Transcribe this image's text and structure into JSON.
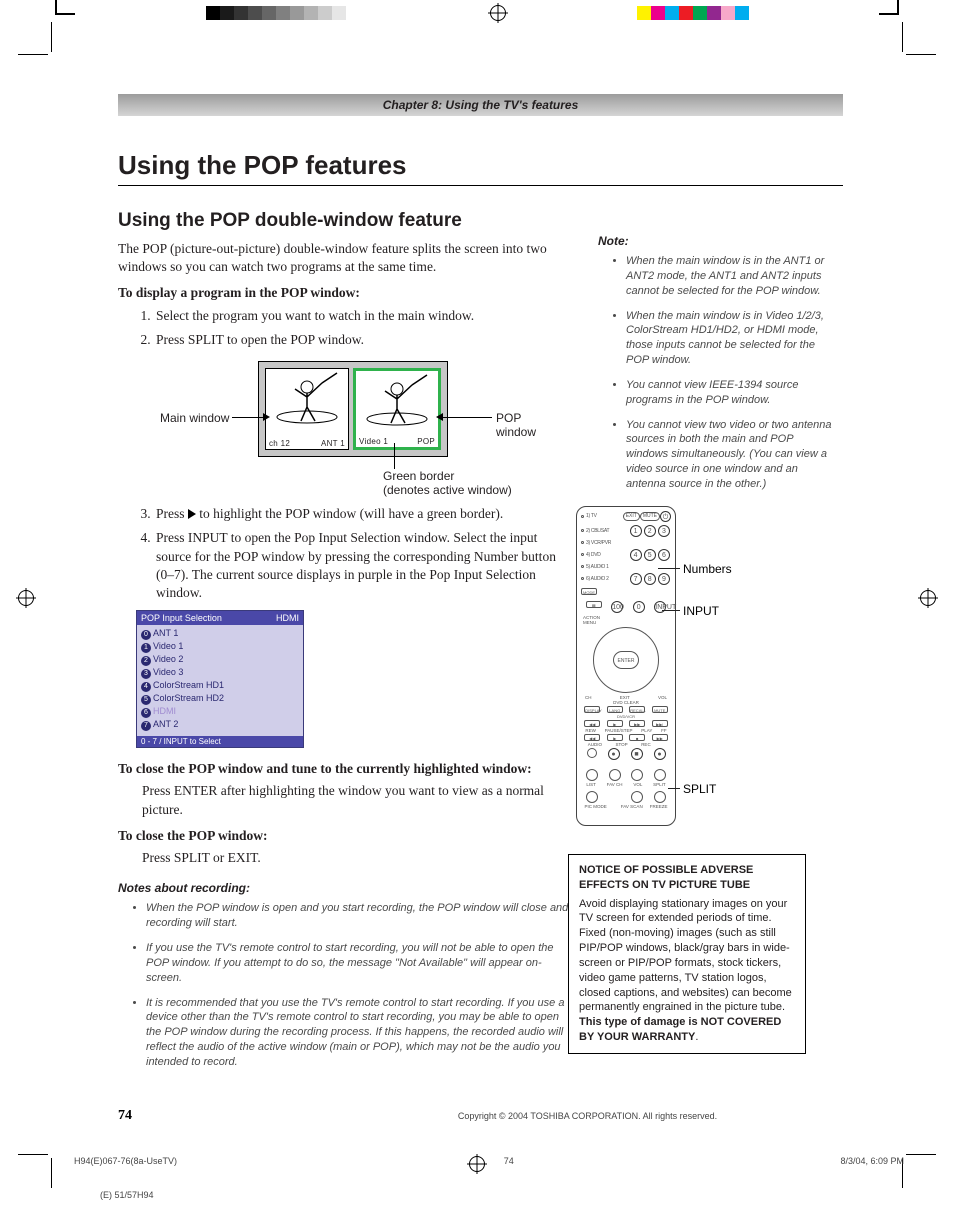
{
  "chapterBar": "Chapter 8: Using the TV's features",
  "h1": "Using the POP features",
  "h2": "Using the POP double-window feature",
  "intro": "The POP (picture-out-picture) double-window feature splits the screen into two windows so you can watch two programs at the same time.",
  "bold1": "To display a program in the POP window:",
  "steps12": [
    "Select the program you want to watch in the main window.",
    "Press SPLIT to open the POP window."
  ],
  "diag": {
    "main": "Main window",
    "pop": "POP window",
    "ch12": "ch 12",
    "ant1": "ANT 1",
    "video1": "Video 1",
    "popLbl": "POP",
    "gb1": "Green border",
    "gb2": "(denotes active window)"
  },
  "steps34": [
    "Press ▶ to highlight the POP window (will have a green border).",
    "Press INPUT to open the Pop Input Selection window. Select the input source for the POP window by pressing the corresponding Number button (0–7). The current source displays in purple in the Pop Input Selection window."
  ],
  "popMenu": {
    "title": "POP Input Selection",
    "right": "HDMI",
    "rows": [
      "ANT 1",
      "Video 1",
      "Video 2",
      "Video 3",
      "ColorStream HD1",
      "ColorStream HD2",
      "HDMI",
      "ANT 2"
    ],
    "foot": "0 - 7 / INPUT to Select"
  },
  "bold2": "To close the POP window and tune to the currently highlighted window:",
  "p2": "Press ENTER after highlighting the window you want to view as a normal picture.",
  "bold3": "To close the POP window:",
  "p3": "Press SPLIT or EXIT.",
  "recNotesHead": "Notes about recording:",
  "recNotes": [
    "When the POP window is open and you start recording, the POP window will close and recording will start.",
    "If you use the TV's remote control to start recording, you will not be able to open the POP window. If you attempt to do so, the message \"Not Available\" will appear on-screen.",
    "It is recommended that you use the TV's remote control to start recording. If you use a device other than the TV's remote control to start recording, you may be able to open the POP window during the recording process. If this happens, the recorded audio will reflect the audio of the active window (main or POP), which may not be the audio you intended to record."
  ],
  "noteHead": "Note:",
  "rightNotes": [
    "When the main window is in the ANT1 or ANT2 mode, the ANT1 and ANT2 inputs cannot be selected for the POP window.",
    "When the main window is in Video 1/2/3, ColorStream HD1/HD2, or HDMI mode, those inputs cannot be selected for the POP window.",
    "You cannot view IEEE-1394 source programs in the POP window.",
    "You cannot view two video or two antenna sources in both the main and POP windows simultaneously. (You can view a video source in one window and an antenna source in the other.)"
  ],
  "remote": {
    "modes": [
      "1) TV",
      "2) CBL/SAT",
      "3) VCR/PVR",
      "4) DVD",
      "5) AUDIO 1",
      "6) AUDIO 2"
    ],
    "MODE": "MODE",
    "EXIT": "EXIT",
    "MUTE": "MUTE",
    "POWER": "POWER",
    "co1": "Numbers",
    "co2": "INPUT",
    "co3": "SPLIT",
    "enter": "ENTER",
    "labels": [
      "REW",
      "PAUSE/STEP",
      "PLAY",
      "FF",
      "AUDIO",
      "STOP",
      "REC"
    ],
    "bottom": [
      "LIST",
      "FAV CH",
      "VOL",
      "SPLIT"
    ],
    "bottom2": [
      "PIC MODE",
      "",
      "FAV SCAN",
      "FREEZE"
    ],
    "corner": [
      "DISPLAY",
      "LANG",
      "RECALL",
      "MUTE"
    ],
    "mid": [
      "◀◀",
      "▶",
      "▶▶",
      "▶▶|"
    ],
    "blk": [
      "DVD/VCR",
      "SKIP/SRCH"
    ],
    "ch": "CH",
    "vol": "VOL",
    "exit2": "EXIT",
    "dvdclear": "DVD CLEAR"
  },
  "notice": {
    "head": "NOTICE OF POSSIBLE ADVERSE EFFECTS ON TV PICTURE TUBE",
    "body1": "Avoid displaying stationary images on your TV screen for extended periods of time. Fixed (non-moving) images (such as still PIP/POP windows, black/gray bars in wide-screen or PIP/POP formats, stock tickers, video game patterns, TV station logos, closed captions, and websites) can become permanently engrained in the picture tube. ",
    "bold": "This type of damage is NOT COVERED BY YOUR WARRANTY",
    "period": "."
  },
  "pageNum": "74",
  "copyright": "Copyright © 2004 TOSHIBA CORPORATION. All rights reserved.",
  "imprint": {
    "file": "H94(E)067-76(8a-UseTV)",
    "pg": "74",
    "ts": "8/3/04, 6:09 PM"
  },
  "slug": "(E) 51/57H94",
  "swatches": {
    "grays": [
      "#000",
      "#1a1a1a",
      "#333",
      "#4d4d4d",
      "#666",
      "#808080",
      "#999",
      "#b3b3b3",
      "#ccc",
      "#e6e6e6",
      "#fff"
    ],
    "colors": [
      "#fff200",
      "#ec008c",
      "#00aeef",
      "#ed1c24",
      "#00a651",
      "#92278f",
      "#f7a8c9",
      "#00adef"
    ]
  }
}
